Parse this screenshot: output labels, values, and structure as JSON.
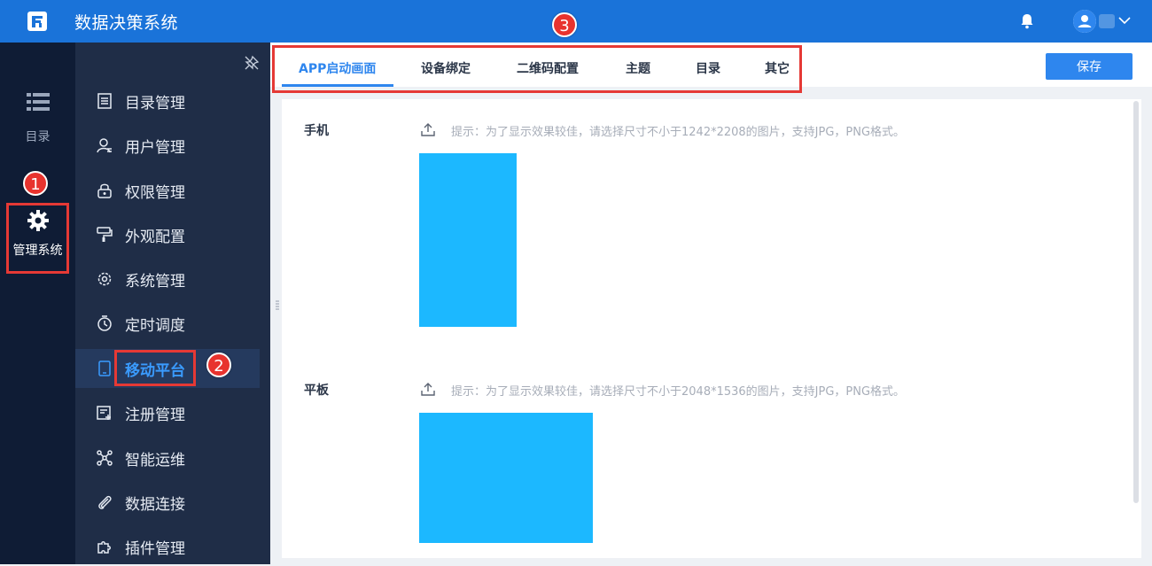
{
  "app": {
    "title": "数据决策系统",
    "brand_color": "#1a73d9"
  },
  "rail": {
    "catalog_label": "目录",
    "manage_label": "管理系统"
  },
  "sidebar": {
    "items": [
      {
        "label": "目录管理",
        "icon": "list-doc-icon"
      },
      {
        "label": "用户管理",
        "icon": "user-icon"
      },
      {
        "label": "权限管理",
        "icon": "lock-icon"
      },
      {
        "label": "外观配置",
        "icon": "paint-roller-icon"
      },
      {
        "label": "系统管理",
        "icon": "gear-icon"
      },
      {
        "label": "定时调度",
        "icon": "timer-icon"
      },
      {
        "label": "移动平台",
        "icon": "tablet-icon",
        "active": true
      },
      {
        "label": "注册管理",
        "icon": "register-icon"
      },
      {
        "label": "智能运维",
        "icon": "network-icon"
      },
      {
        "label": "数据连接",
        "icon": "paperclip-icon"
      },
      {
        "label": "插件管理",
        "icon": "puzzle-icon"
      }
    ]
  },
  "tabs": [
    {
      "label": "APP启动画面",
      "active": true
    },
    {
      "label": "设备绑定"
    },
    {
      "label": "二维码配置"
    },
    {
      "label": "主题"
    },
    {
      "label": "目录"
    },
    {
      "label": "其它"
    }
  ],
  "toolbar": {
    "save_label": "保存"
  },
  "sections": [
    {
      "label": "手机",
      "hint": "提示：为了显示效果较佳，请选择尺寸不小于1242*2208的图片，支持JPG，PNG格式。"
    },
    {
      "label": "平板",
      "hint": "提示：为了显示效果较佳，请选择尺寸不小于2048*1536的图片，支持JPG，PNG格式。"
    }
  ],
  "annotations": {
    "badge1": "1",
    "badge2": "2",
    "badge3": "3"
  },
  "colors": {
    "preview": "#1cb8ff",
    "accent": "#2e86ee",
    "annotation": "#e53935"
  }
}
